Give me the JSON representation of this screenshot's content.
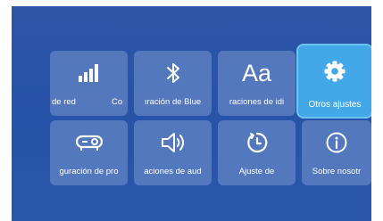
{
  "tiles": [
    {
      "label": "de red",
      "label_extra": "Co",
      "icon": "signal-bars-icon"
    },
    {
      "label": "ıración de Blue",
      "icon": "bluetooth-icon"
    },
    {
      "label": "raciones de idi",
      "icon": "aa-language-icon",
      "glyph": "Aa"
    },
    {
      "label": "Otros ajustes",
      "icon": "gear-icon",
      "selected": true
    },
    {
      "label": "guración de pro",
      "icon": "projector-icon"
    },
    {
      "label": "aciones de aud",
      "icon": "speaker-icon"
    },
    {
      "label": "Ajuste de",
      "icon": "clock-icon"
    },
    {
      "label": "Sobre nosotr",
      "icon": "info-icon"
    }
  ],
  "colors": {
    "background": "#2753a8",
    "tile": "#6b8fd0",
    "selected_tile": "#42a8e8"
  }
}
